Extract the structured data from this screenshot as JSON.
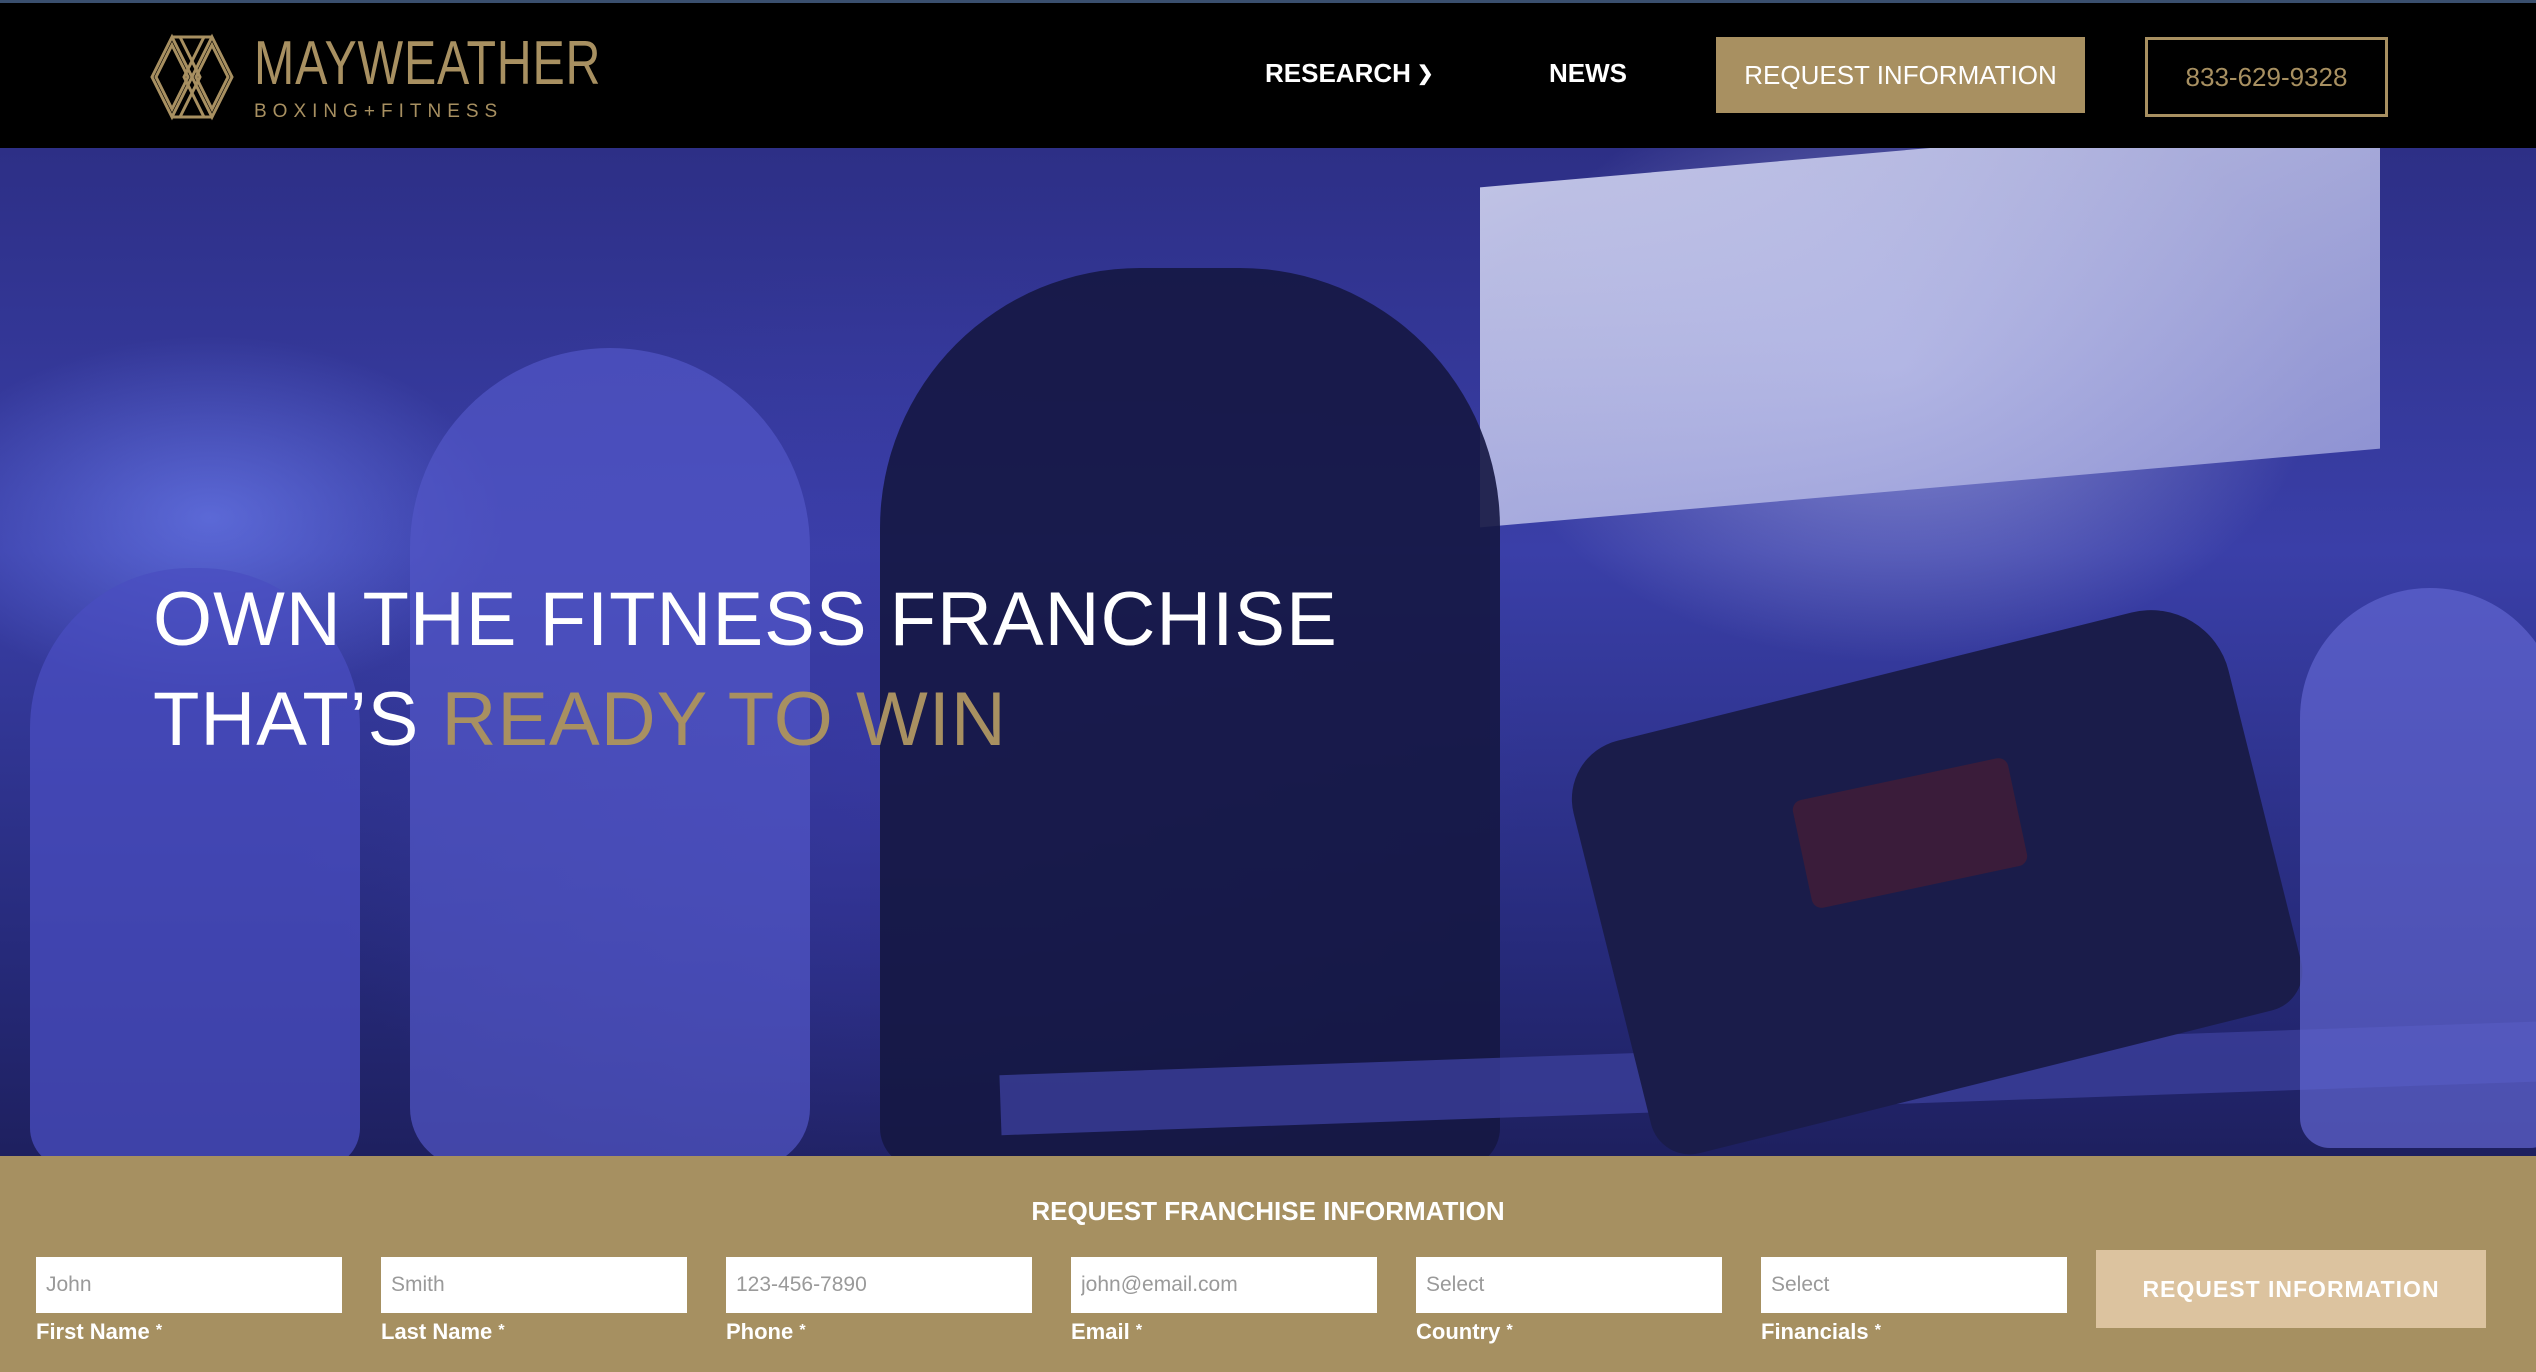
{
  "colors": {
    "brand_gold": "#a89061",
    "header_bg": "#000000",
    "form_bg": "#a69061",
    "submit_bg": "#dcc39f"
  },
  "header": {
    "logo": {
      "brand": "MAYWEATHER",
      "subtitle": "BOXING+FITNESS",
      "icon": "diamond-logo-icon"
    },
    "nav": {
      "research": "RESEARCH",
      "research_icon": "chevron-down-icon",
      "news": "NEWS"
    },
    "request_button": "REQUEST INFORMATION",
    "phone_button": "833-629-9328"
  },
  "hero": {
    "line1": "OWN THE FITNESS FRANCHISE",
    "line2_prefix": "THAT’S ",
    "line2_accent": "READY TO WIN"
  },
  "form": {
    "title": "REQUEST FRANCHISE INFORMATION",
    "fields": [
      {
        "label": "First Name",
        "placeholder": "John",
        "required": "*"
      },
      {
        "label": "Last Name",
        "placeholder": "Smith",
        "required": "*"
      },
      {
        "label": "Phone",
        "placeholder": "123-456-7890",
        "required": "*"
      },
      {
        "label": "Email",
        "placeholder": "john@email.com",
        "required": "*"
      },
      {
        "label": "Country",
        "placeholder": "Select",
        "required": "*"
      },
      {
        "label": "Financials",
        "placeholder": "Select",
        "required": "*"
      }
    ],
    "submit": "REQUEST INFORMATION"
  }
}
